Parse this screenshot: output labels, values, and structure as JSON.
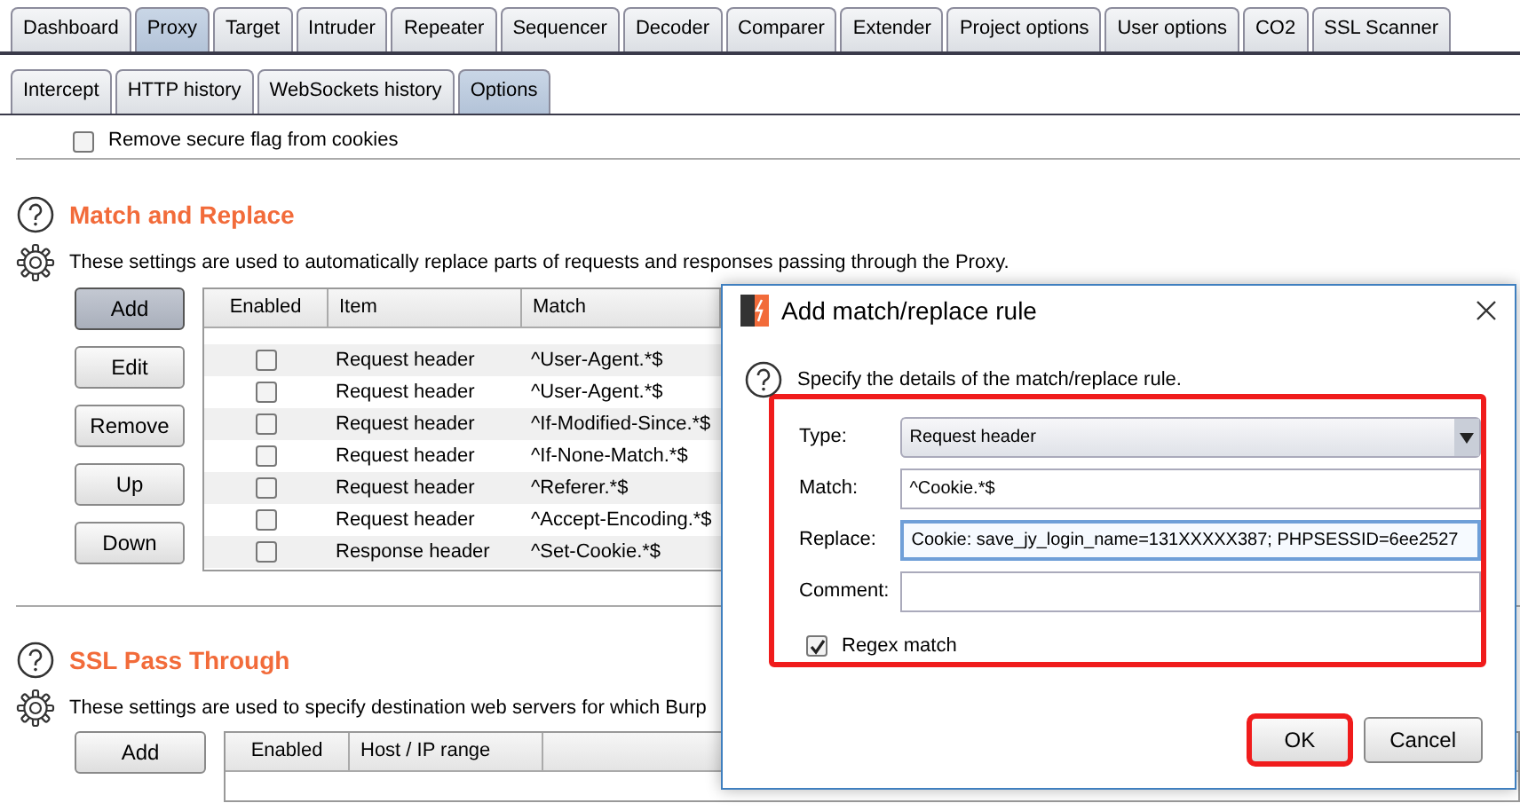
{
  "main_tabs": [
    {
      "label": "Dashboard",
      "selected": false
    },
    {
      "label": "Proxy",
      "selected": true
    },
    {
      "label": "Target",
      "selected": false
    },
    {
      "label": "Intruder",
      "selected": false
    },
    {
      "label": "Repeater",
      "selected": false
    },
    {
      "label": "Sequencer",
      "selected": false
    },
    {
      "label": "Decoder",
      "selected": false
    },
    {
      "label": "Comparer",
      "selected": false
    },
    {
      "label": "Extender",
      "selected": false
    },
    {
      "label": "Project options",
      "selected": false
    },
    {
      "label": "User options",
      "selected": false
    },
    {
      "label": "CO2",
      "selected": false
    },
    {
      "label": "SSL Scanner",
      "selected": false
    }
  ],
  "sub_tabs": [
    {
      "label": "Intercept",
      "selected": false
    },
    {
      "label": "HTTP history",
      "selected": false
    },
    {
      "label": "WebSockets history",
      "selected": false
    },
    {
      "label": "Options",
      "selected": true
    }
  ],
  "remove_secure_flag": {
    "label": "Remove secure flag from cookies",
    "checked": false
  },
  "match_replace": {
    "title": "Match and Replace",
    "description": "These settings are used to automatically replace parts of requests and responses passing through the Proxy.",
    "buttons": [
      {
        "label": "Add",
        "pressed": true
      },
      {
        "label": "Edit",
        "pressed": false
      },
      {
        "label": "Remove",
        "pressed": false
      },
      {
        "label": "Up",
        "pressed": false
      },
      {
        "label": "Down",
        "pressed": false
      }
    ],
    "columns": [
      "Enabled",
      "Item",
      "Match"
    ],
    "rows": [
      {
        "enabled": false,
        "item": "Request header",
        "match": "^User-Agent.*$"
      },
      {
        "enabled": false,
        "item": "Request header",
        "match": "^User-Agent.*$"
      },
      {
        "enabled": false,
        "item": "Request header",
        "match": "^If-Modified-Since.*$"
      },
      {
        "enabled": false,
        "item": "Request header",
        "match": "^If-None-Match.*$"
      },
      {
        "enabled": false,
        "item": "Request header",
        "match": "^Referer.*$"
      },
      {
        "enabled": false,
        "item": "Request header",
        "match": "^Accept-Encoding.*$"
      },
      {
        "enabled": false,
        "item": "Response header",
        "match": "^Set-Cookie.*$"
      }
    ]
  },
  "ssl_pass_through": {
    "title": "SSL Pass Through",
    "description": "These settings are used to specify destination web servers for which Burp",
    "buttons": [
      {
        "label": "Add",
        "pressed": false
      }
    ],
    "columns": [
      "Enabled",
      "Host / IP range"
    ]
  },
  "dialog": {
    "title": "Add match/replace rule",
    "intro": "Specify the details of the match/replace rule.",
    "form_highlighted": true,
    "fields": [
      {
        "kind": "select",
        "label": "Type:",
        "value": "Request header",
        "focused": false
      },
      {
        "kind": "text",
        "label": "Match:",
        "value": "^Cookie.*$",
        "focused": false
      },
      {
        "kind": "text",
        "label": "Replace:",
        "value": "Cookie: save_jy_login_name=131XXXXX387;  PHPSESSID=6ee2527",
        "focused": true
      },
      {
        "kind": "text",
        "label": "Comment:",
        "focused": false
      }
    ],
    "regex_match": {
      "label": "Regex match",
      "checked": true
    },
    "buttons": [
      {
        "label": "OK",
        "highlighted": true
      },
      {
        "label": "Cancel",
        "highlighted": false
      }
    ]
  }
}
